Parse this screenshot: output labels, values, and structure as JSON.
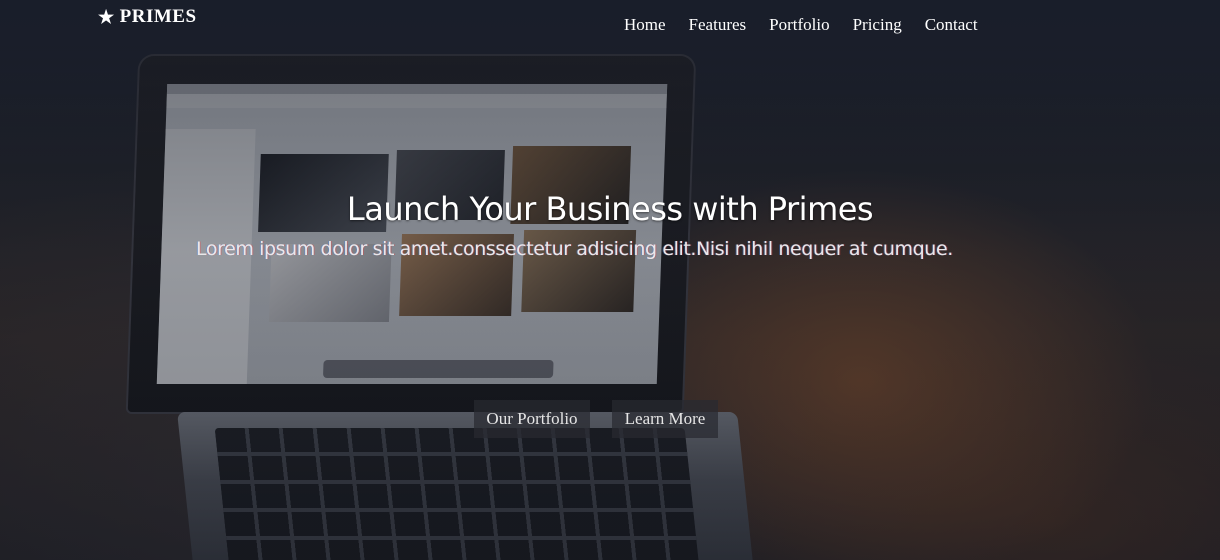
{
  "brand": {
    "name": "PRIMES",
    "icon": "star-icon"
  },
  "nav": {
    "items": [
      {
        "label": "Home"
      },
      {
        "label": "Features"
      },
      {
        "label": "Portfolio"
      },
      {
        "label": "Pricing"
      },
      {
        "label": "Contact"
      }
    ]
  },
  "hero": {
    "headline": "Launch Your Business with Primes",
    "subtitle": "Lorem ipsum dolor sit amet.conssectetur adisicing elit.Nisi nihil nequer at cumque.",
    "buttons": {
      "portfolio_label": "Our Portfolio",
      "learn_more_label": "Learn More"
    }
  },
  "colors": {
    "text": "#ffffff",
    "button_bg": "#2a2c32",
    "overlay": "#0a0e18"
  }
}
